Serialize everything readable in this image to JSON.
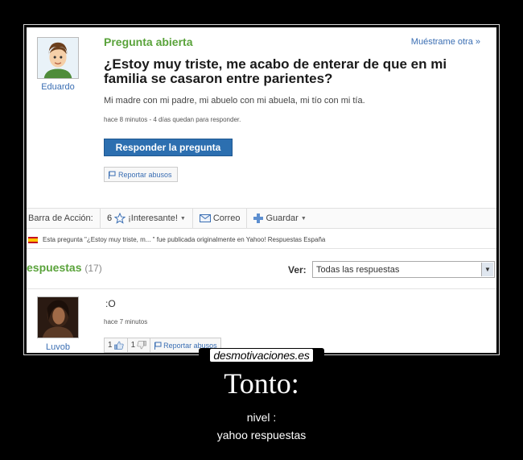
{
  "question": {
    "status": "Pregunta abierta",
    "show_other": "Muéstrame otra »",
    "user": "Eduardo",
    "title": "¿Estoy muy triste, me acabo de enterar de que en mi familia se casaron entre parientes?",
    "body": "Mi madre con mi padre, mi abuelo con mi abuela, mi tío con mi tía.",
    "meta": "hace 8 minutos - 4 días quedan para responder.",
    "answer_button": "Responder la pregunta",
    "report_button": "Reportar abusos"
  },
  "action_bar": {
    "label": "Barra de Acción:",
    "interesting_count": "6",
    "interesting_label": "¡Interesante!",
    "email_label": "Correo",
    "save_label": "Guardar"
  },
  "notice": {
    "text": "Esta pregunta \"¿Estoy muy triste, m... \" fue publicada originalmente en Yahoo! Respuestas España"
  },
  "answers": {
    "title": "espuestas",
    "count": "(17)",
    "view_label": "Ver:",
    "view_value": "Todas las respuestas"
  },
  "answer": {
    "user": "Luvob",
    "text": ":O",
    "meta": "hace 7 minutos",
    "thumbs_up": "1",
    "thumbs_down": "1",
    "report": "Reportar abusos"
  },
  "watermark": "desmotivaciones.es",
  "caption": {
    "title": "Tonto:",
    "line1": "nivel :",
    "line2": "yahoo respuestas"
  },
  "colors": {
    "accent_green": "#5aa33b",
    "link_blue": "#3a6eb3",
    "button_blue": "#2c6fb0"
  }
}
